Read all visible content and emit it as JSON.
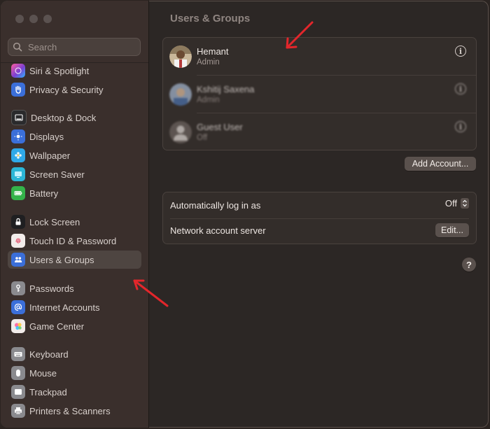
{
  "sidebar": {
    "search_placeholder": "Search",
    "items": [
      {
        "label": "Siri & Spotlight",
        "icon": "siri-icon",
        "color": "#7d3fd1",
        "top": 0
      },
      {
        "label": "Privacy & Security",
        "icon": "hand-icon",
        "color": "#3b82f6",
        "top": 0
      },
      {
        "label": "Desktop & Dock",
        "icon": "dock-icon",
        "color": "#3a3a3c",
        "top": 0
      },
      {
        "label": "Displays",
        "icon": "sun-icon",
        "color": "#3b82f6",
        "top": 0
      },
      {
        "label": "Wallpaper",
        "icon": "flower-icon",
        "color": "#38bdf8",
        "top": 0
      },
      {
        "label": "Screen Saver",
        "icon": "screensaver-icon",
        "color": "#22c3e6",
        "top": 0
      },
      {
        "label": "Battery",
        "icon": "battery-icon",
        "color": "#34c759",
        "top": 0
      },
      {
        "label": "Lock Screen",
        "icon": "lock-icon",
        "color": "#2c2c2e",
        "top": 0
      },
      {
        "label": "Touch ID & Password",
        "icon": "fingerprint-icon",
        "color": "#f5f5f5",
        "top": 0
      },
      {
        "label": "Users & Groups",
        "icon": "users-icon",
        "color": "#3b82f6",
        "top": 0,
        "selected": true
      },
      {
        "label": "Passwords",
        "icon": "key-icon",
        "color": "#8e8e93",
        "top": 0
      },
      {
        "label": "Internet Accounts",
        "icon": "at-icon",
        "color": "#3b82f6",
        "top": 0
      },
      {
        "label": "Game Center",
        "icon": "game-center-icon",
        "color": "#f5f5f5",
        "top": 0
      },
      {
        "label": "Keyboard",
        "icon": "keyboard-icon",
        "color": "#8e8e93",
        "top": 0
      },
      {
        "label": "Mouse",
        "icon": "mouse-icon",
        "color": "#8e8e93",
        "top": 0
      },
      {
        "label": "Trackpad",
        "icon": "trackpad-icon",
        "color": "#8e8e93",
        "top": 0
      },
      {
        "label": "Printers & Scanners",
        "icon": "printer-icon",
        "color": "#8e8e93",
        "top": 0
      }
    ]
  },
  "main": {
    "title": "Users & Groups",
    "users": [
      {
        "name": "Hemant",
        "role": "Admin"
      },
      {
        "name": "Kshitij Saxena",
        "role": "Admin"
      },
      {
        "name": "Guest User",
        "role": "Off"
      }
    ],
    "add_account_label": "Add Account...",
    "auto_login_label": "Automatically log in as",
    "auto_login_value": "Off",
    "network_server_label": "Network account server",
    "edit_label": "Edit...",
    "help_label": "?"
  },
  "colors": {
    "sidebar_bg": "#3a2f2c",
    "main_bg": "#2c2725",
    "annotation_arrow": "#e3262b"
  }
}
